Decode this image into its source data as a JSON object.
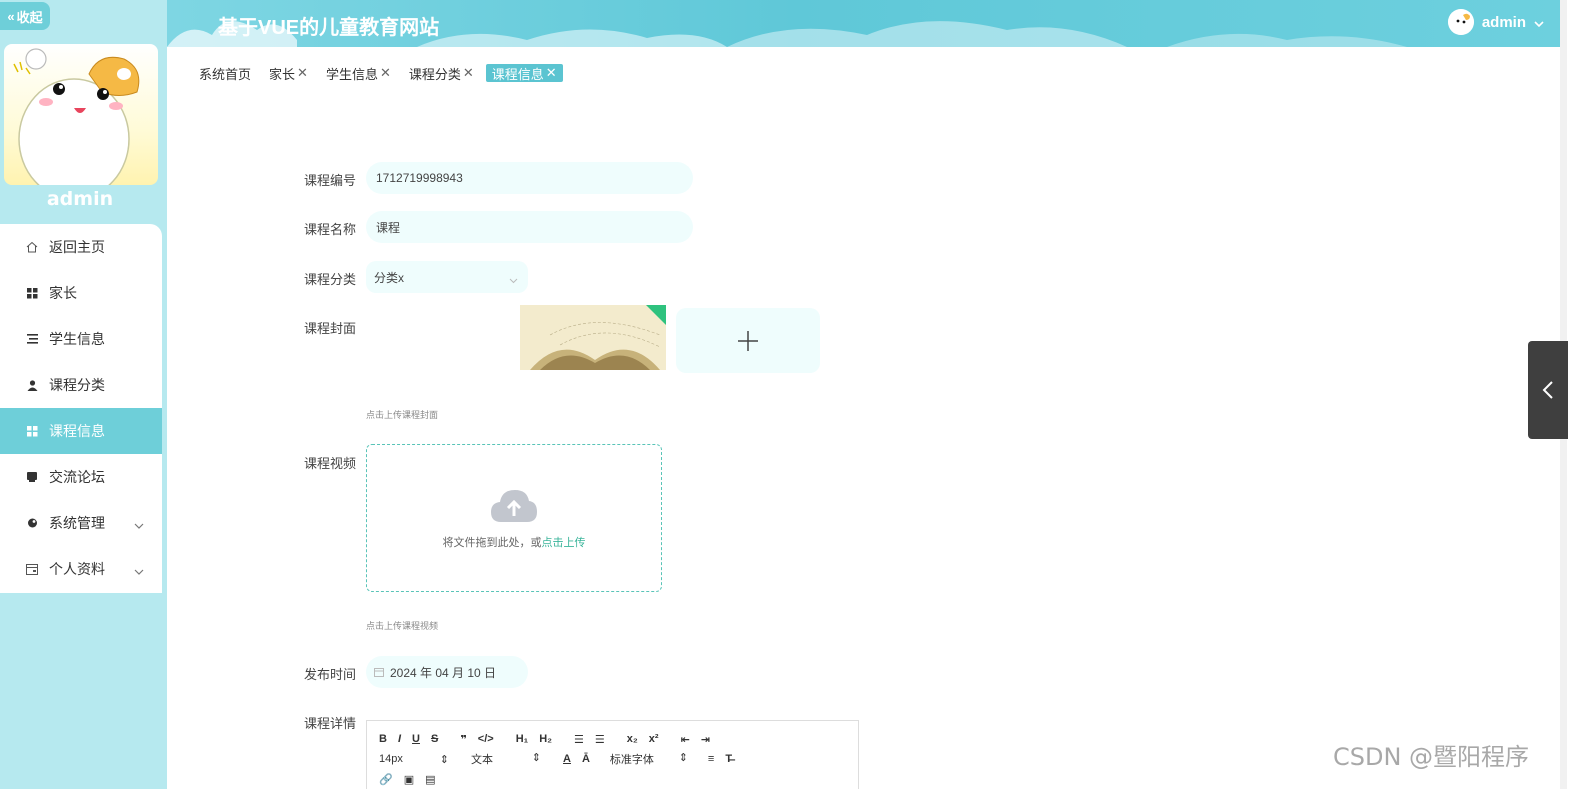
{
  "sidebar": {
    "collapse_label": "收起",
    "username": "admin",
    "items": [
      {
        "label": "返回主页",
        "icon": "home-icon"
      },
      {
        "label": "家长",
        "icon": "grid-icon"
      },
      {
        "label": "学生信息",
        "icon": "list-icon"
      },
      {
        "label": "课程分类",
        "icon": "user-icon"
      },
      {
        "label": "课程信息",
        "icon": "grid-icon",
        "active": true
      },
      {
        "label": "交流论坛",
        "icon": "chat-icon"
      },
      {
        "label": "系统管理",
        "icon": "settings-icon"
      },
      {
        "label": "个人资料",
        "icon": "profile-icon"
      }
    ]
  },
  "header": {
    "title": "基于VUE的儿童教育网站",
    "user": "admin"
  },
  "tabs": [
    {
      "label": "系统首页",
      "closable": false
    },
    {
      "label": "家长",
      "closable": true
    },
    {
      "label": "学生信息",
      "closable": true
    },
    {
      "label": "课程分类",
      "closable": true
    },
    {
      "label": "课程信息",
      "closable": true,
      "active": true
    }
  ],
  "form": {
    "course_no": {
      "label": "课程编号",
      "value": "1712719998943"
    },
    "course_name": {
      "label": "课程名称",
      "value": "课程"
    },
    "course_category": {
      "label": "课程分类",
      "value": "分类x"
    },
    "course_cover": {
      "label": "课程封面",
      "hint": "点击上传课程封面"
    },
    "course_video": {
      "label": "课程视频",
      "drop_text": "将文件拖到此处，或",
      "drop_link": "点击上传",
      "hint": "点击上传课程视频"
    },
    "publish_time": {
      "label": "发布时间",
      "value": "2024 年 04 月 10 日"
    },
    "course_detail": {
      "label": "课程详情"
    }
  },
  "editor": {
    "font_size": "14px",
    "text_type": "文本",
    "font_family": "标准字体"
  },
  "watermark": "CSDN @暨阳程序"
}
